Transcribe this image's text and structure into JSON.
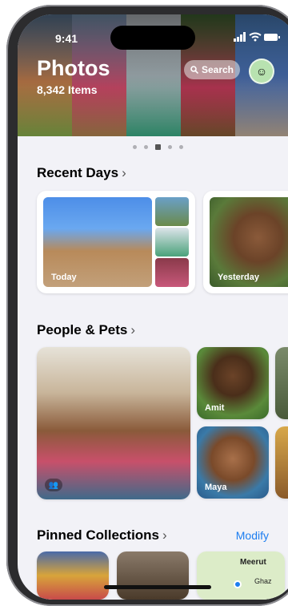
{
  "status_bar": {
    "time": "9:41",
    "icons": "▮▮▮ ◠ ▬"
  },
  "header": {
    "title": "Photos",
    "count": "8,342 Items",
    "search_label": "Search",
    "avatar_icon": "memoji-avatar"
  },
  "sections": {
    "recent_days": {
      "title": "Recent Days",
      "cards": [
        {
          "label": "Today"
        },
        {
          "label": "Yesterday"
        }
      ]
    },
    "people_pets": {
      "title": "People & Pets",
      "people": [
        {
          "label": "Amit"
        },
        {
          "label": "Maya"
        }
      ]
    },
    "pinned": {
      "title": "Pinned Collections",
      "modify_label": "Modify",
      "map_labels": [
        "Meerut",
        "Ghaz"
      ]
    }
  },
  "colors": {
    "accent": "#1d7ef0",
    "background": "#f2f2f7"
  }
}
